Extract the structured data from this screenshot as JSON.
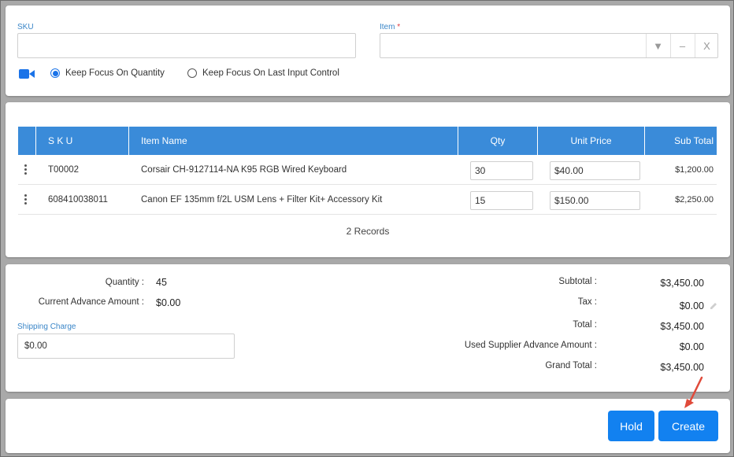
{
  "form": {
    "sku_label": "SKU",
    "sku_value": "",
    "item_label": "Item",
    "item_required": "*",
    "item_value": "",
    "combo_dropdown_glyph": "▼",
    "combo_clear_glyph": "–",
    "combo_close_glyph": "X",
    "radio_options": [
      {
        "label": "Keep Focus On Quantity",
        "selected": true
      },
      {
        "label": "Keep Focus On Last Input Control",
        "selected": false
      }
    ]
  },
  "grid": {
    "columns": [
      "S K U",
      "Item Name",
      "Qty",
      "Unit Price",
      "Sub Total"
    ],
    "rows": [
      {
        "sku": "T00002",
        "name": "Corsair CH-9127114-NA K95 RGB Wired Keyboard",
        "qty": "30",
        "unit_price": "$40.00",
        "sub_total": "$1,200.00"
      },
      {
        "sku": "608410038011",
        "name": "Canon EF 135mm f/2L USM Lens + Filter Kit+ Accessory Kit",
        "qty": "15",
        "unit_price": "$150.00",
        "sub_total": "$2,250.00"
      }
    ],
    "records_text": "2 Records"
  },
  "summary": {
    "quantity_label": "Quantity :",
    "quantity_value": "45",
    "advance_label": "Current Advance Amount :",
    "advance_value": "$0.00",
    "shipping_label": "Shipping Charge",
    "shipping_value": "$0.00",
    "subtotal_label": "Subtotal :",
    "subtotal_value": "$3,450.00",
    "tax_label": "Tax :",
    "tax_value": "$0.00",
    "total_label": "Total :",
    "total_value": "$3,450.00",
    "used_advance_label": "Used Supplier Advance Amount :",
    "used_advance_value": "$0.00",
    "grand_total_label": "Grand Total :",
    "grand_total_value": "$3,450.00"
  },
  "actions": {
    "hold_label": "Hold",
    "create_label": "Create"
  },
  "colors": {
    "accent": "#1281f0",
    "grid_header": "#3a8bd9",
    "label_blue": "#3a86c8",
    "annotation_arrow": "#e04a3a"
  },
  "icons": [
    "camera-icon",
    "pencil-icon",
    "kebab-menu-icon",
    "annotation-arrow"
  ]
}
